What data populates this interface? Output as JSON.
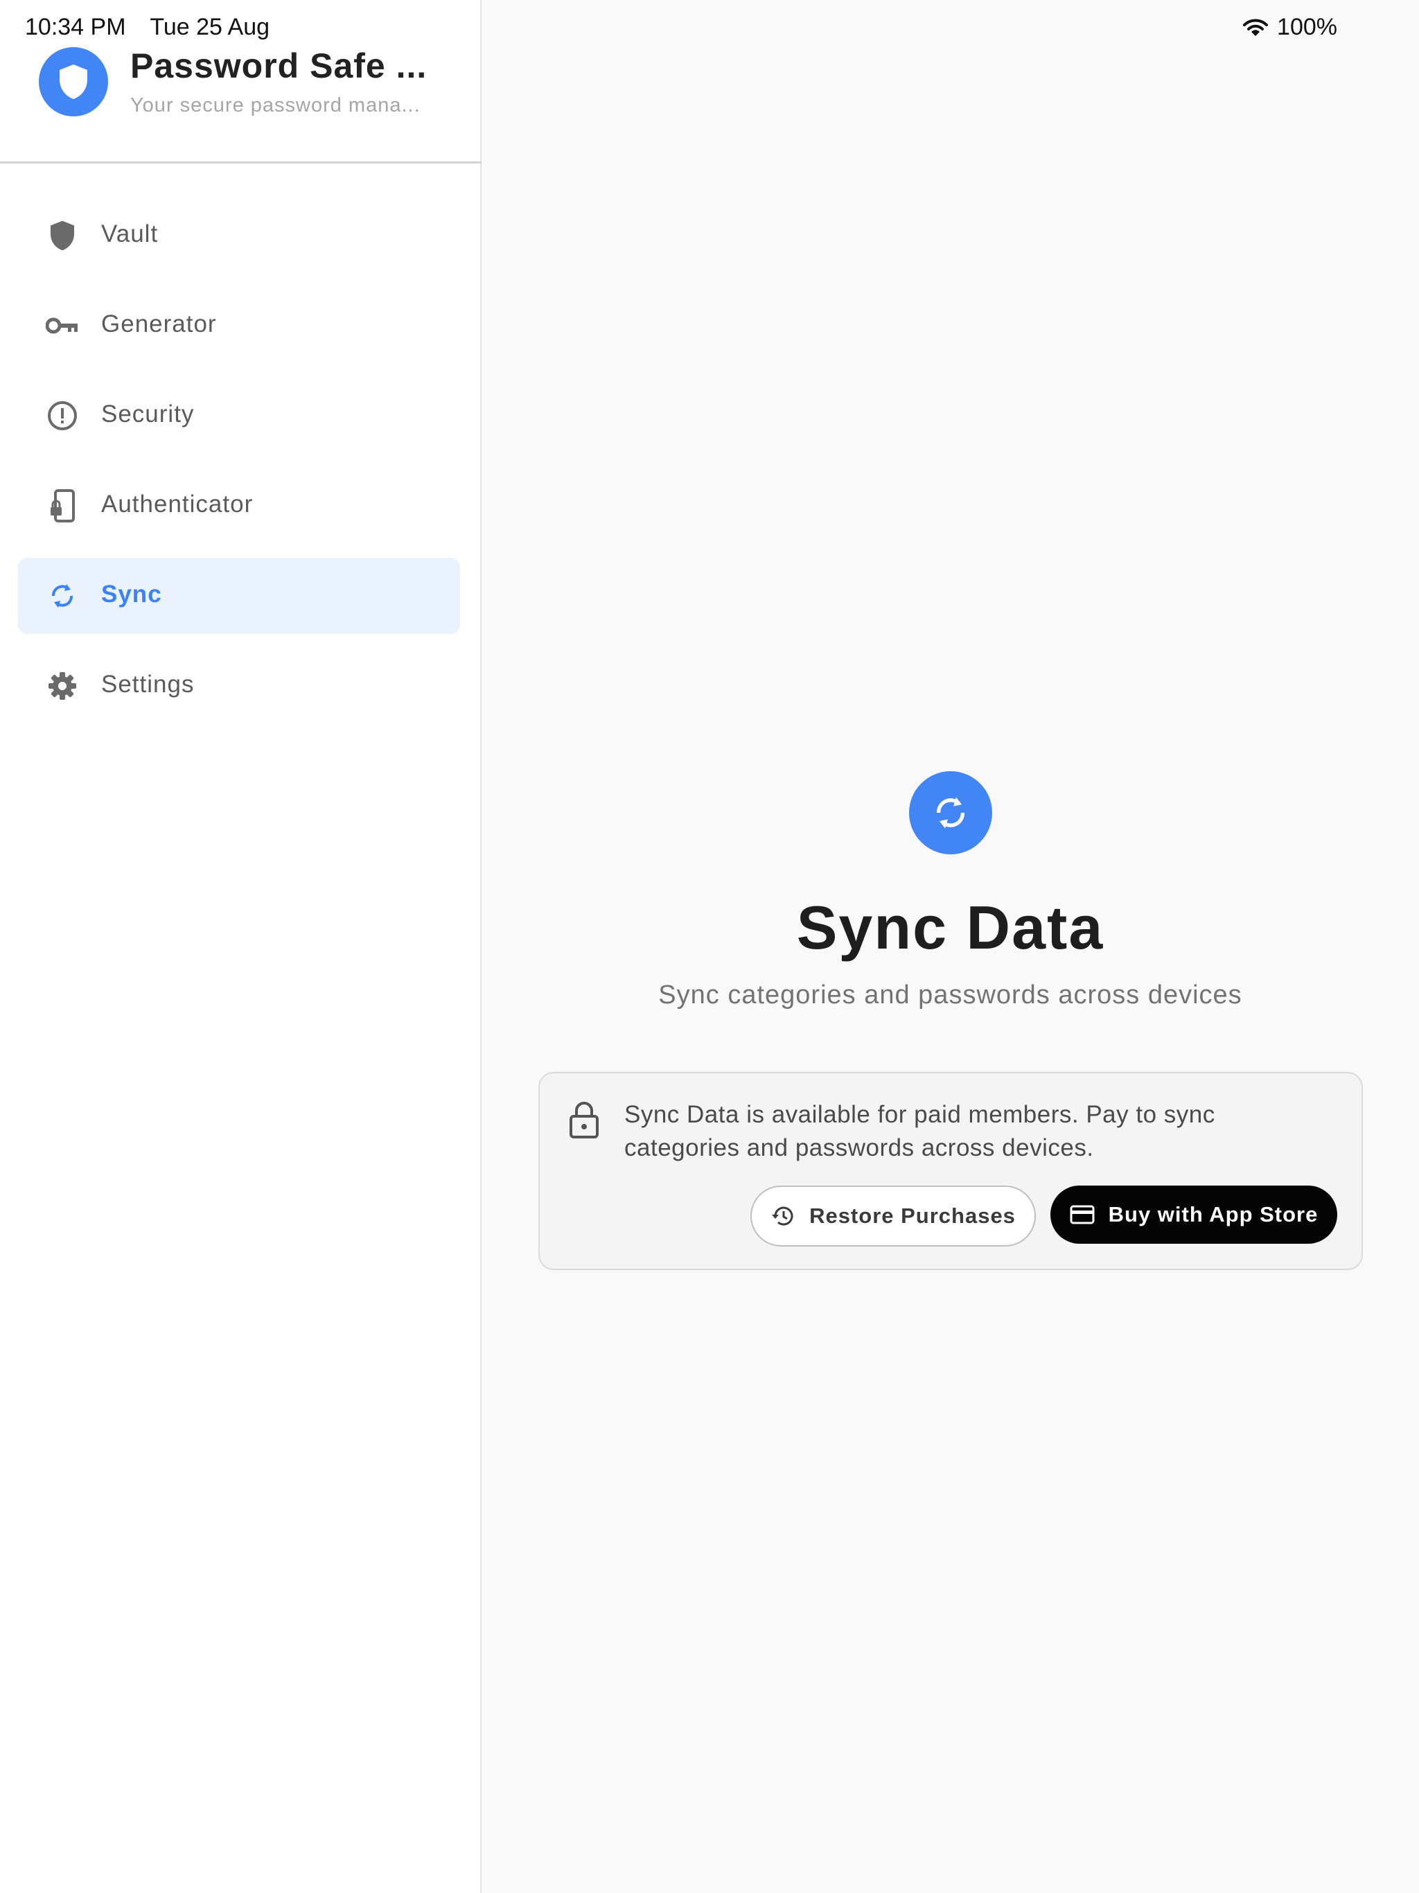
{
  "status_bar": {
    "time": "10:34 PM",
    "date": "Tue 25 Aug",
    "battery": "100%"
  },
  "sidebar": {
    "app_title": "Password Safe ...",
    "app_subtitle": "Your secure password mana...",
    "items": [
      {
        "label": "Vault",
        "icon": "shield-icon",
        "active": false
      },
      {
        "label": "Generator",
        "icon": "key-icon",
        "active": false
      },
      {
        "label": "Security",
        "icon": "alert-circle-icon",
        "active": false
      },
      {
        "label": "Authenticator",
        "icon": "phone-lock-icon",
        "active": false
      },
      {
        "label": "Sync",
        "icon": "sync-icon",
        "active": true
      },
      {
        "label": "Settings",
        "icon": "gear-icon",
        "active": false
      }
    ]
  },
  "main": {
    "title": "Sync Data",
    "subtitle": "Sync categories and passwords across devices",
    "notice": {
      "text": "Sync Data is available for paid members. Pay to sync categories and passwords across devices.",
      "restore_label": "Restore Purchases",
      "buy_label": "Buy with App Store"
    }
  },
  "colors": {
    "accent": "#4285f4",
    "active_bg": "#eaf2fe",
    "active_text": "#3b82f6",
    "buy_button": "#050505"
  }
}
